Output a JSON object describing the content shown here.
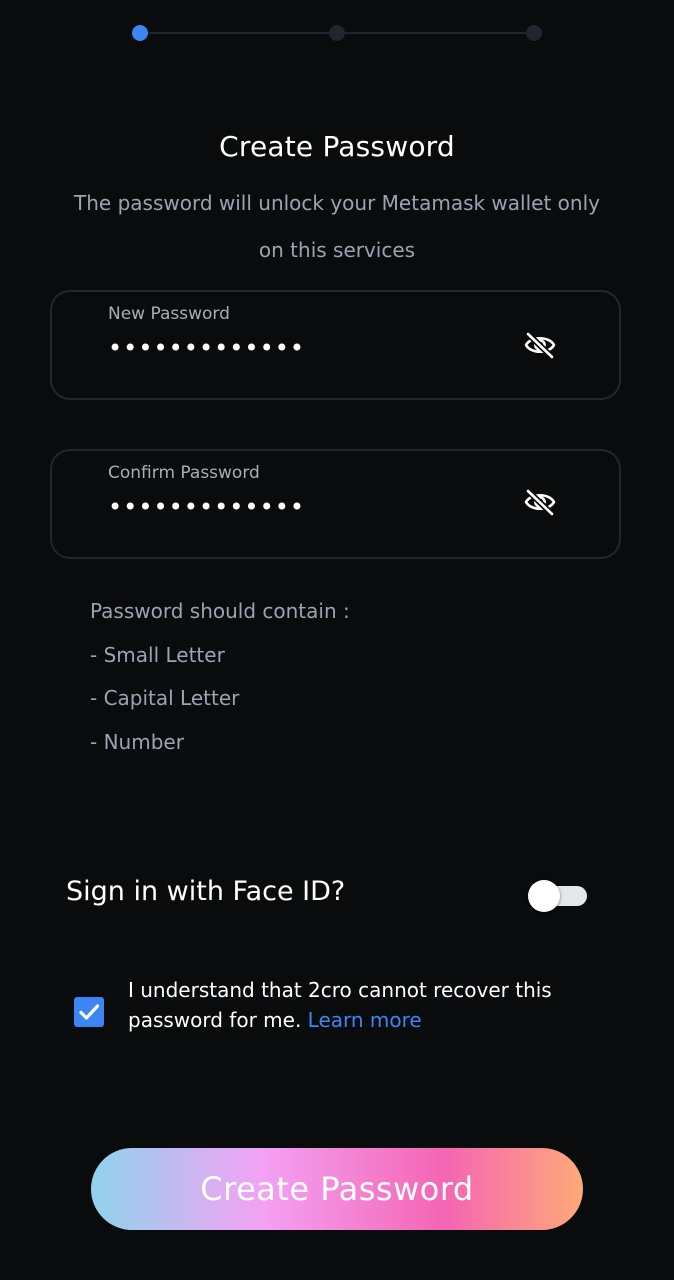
{
  "stepper": {
    "total_steps": 3,
    "current_step": 1
  },
  "header": {
    "title": "Create Password",
    "subtitle": "The password will unlock your Metamask wallet only on this services"
  },
  "new_password": {
    "label": "New Password",
    "value": "•••••••••••••",
    "visibility_icon": "eye-off-icon"
  },
  "confirm_password": {
    "label": "Confirm Password",
    "value": "•••••••••••••",
    "visibility_icon": "eye-off-icon"
  },
  "requirements": {
    "heading": "Password should contain :",
    "items": [
      "- Small Letter",
      "- Capital Letter",
      "- Number"
    ]
  },
  "face_id": {
    "label": "Sign in with Face ID?",
    "enabled": false
  },
  "agreement": {
    "checked": true,
    "text": "I understand that 2cro cannot recover this password for me.",
    "link_label": "Learn more"
  },
  "cta": {
    "label": "Create Password"
  },
  "colors": {
    "accent": "#3c86f4",
    "background": "#0a0b0d",
    "muted_text": "#9aa4b2",
    "field_border": "#1f2830",
    "gradient": [
      "#8fd3ec",
      "#f4a1f4",
      "#f565b3",
      "#fea978"
    ]
  }
}
